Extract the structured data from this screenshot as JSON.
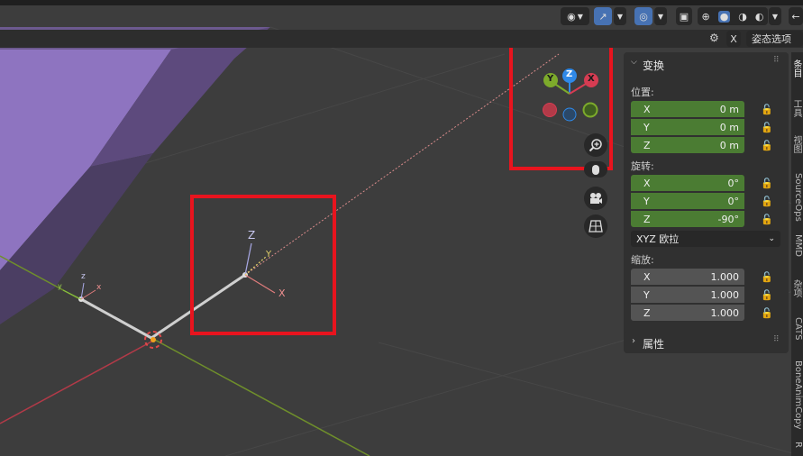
{
  "header": {
    "mode_menu": "姿态选项",
    "x_toggle": "X"
  },
  "gizmo": {
    "x_label": "X",
    "y_label": "Y",
    "z_label": "Z"
  },
  "armature": {
    "bone_a": {
      "x": "x",
      "y": "y",
      "z": "z"
    },
    "bone_b": {
      "x": "X",
      "y": "Y",
      "z": "Z"
    }
  },
  "panel": {
    "transform_title": "变换",
    "location_label": "位置:",
    "location": [
      {
        "axis": "X",
        "value": "0 m"
      },
      {
        "axis": "Y",
        "value": "0 m"
      },
      {
        "axis": "Z",
        "value": "0 m"
      }
    ],
    "rotation_label": "旋转:",
    "rotation": [
      {
        "axis": "X",
        "value": "0°"
      },
      {
        "axis": "Y",
        "value": "0°"
      },
      {
        "axis": "Z",
        "value": "-90°"
      }
    ],
    "rotation_mode": "XYZ 欧拉",
    "scale_label": "缩放:",
    "scale": [
      {
        "axis": "X",
        "value": "1.000"
      },
      {
        "axis": "Y",
        "value": "1.000"
      },
      {
        "axis": "Z",
        "value": "1.000"
      }
    ],
    "properties_title": "属性"
  },
  "sidetabs": [
    "条目",
    "工具",
    "视图",
    "SourceOps",
    "MMD",
    "杂项",
    "CATS",
    "BoneAnimCopy",
    "R"
  ],
  "colors": {
    "viewport_bg": "#3d3d3d",
    "purple_mesh": "#7a5fa8",
    "x_axis": "#d63c52",
    "y_axis": "#7dab2b",
    "z_axis": "#2f89e8",
    "highlight_box": "#e8141e",
    "field_green": "#4b7c33"
  }
}
